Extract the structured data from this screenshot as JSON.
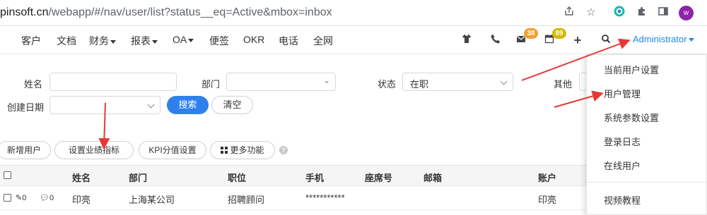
{
  "browser": {
    "url_host": "pinsoft.cn",
    "url_path": "/webapp/#/nav/user/list?status__eq=Active&mbox=inbox",
    "avatar_letter": "w"
  },
  "nav": {
    "items": [
      {
        "label": "客户"
      },
      {
        "label": "文档"
      },
      {
        "label": "财务"
      },
      {
        "label": "报表"
      },
      {
        "label": "OA"
      },
      {
        "label": "便签"
      },
      {
        "label": "OKR"
      },
      {
        "label": "电话"
      },
      {
        "label": "全网"
      }
    ],
    "badges": {
      "mail": "38",
      "calendar": "89"
    },
    "badge_colors": {
      "mail": "#f0a030",
      "calendar": "#d4b800"
    },
    "user": "Administrator"
  },
  "filters": {
    "name_label": "姓名",
    "dept_label": "部门",
    "status_label": "状态",
    "status_value": "在职",
    "other_label": "其他",
    "created_label": "创建日期",
    "search_button": "搜索",
    "clear_button": "清空"
  },
  "toolbar": {
    "new_user": "新增用户",
    "set_target": "设置业绩指标",
    "kpi": "KPI分值设置",
    "more": "更多功能"
  },
  "table": {
    "headers": [
      "姓名",
      "部门",
      "职位",
      "手机",
      "座席号",
      "邮箱",
      "账户"
    ],
    "rows": [
      {
        "comments": "0",
        "messages": "0",
        "name": "印亮",
        "dept": "上海某公司",
        "position": "招聘顾问",
        "phone": "***********",
        "seat": "",
        "email": "",
        "account": "印亮"
      }
    ]
  },
  "menu": {
    "items": [
      "当前用户设置",
      "用户管理",
      "系统参数设置",
      "登录日志",
      "在线用户",
      "视频教程"
    ]
  },
  "accent_color": "#2f80ed",
  "annotation_color": "#e53935"
}
